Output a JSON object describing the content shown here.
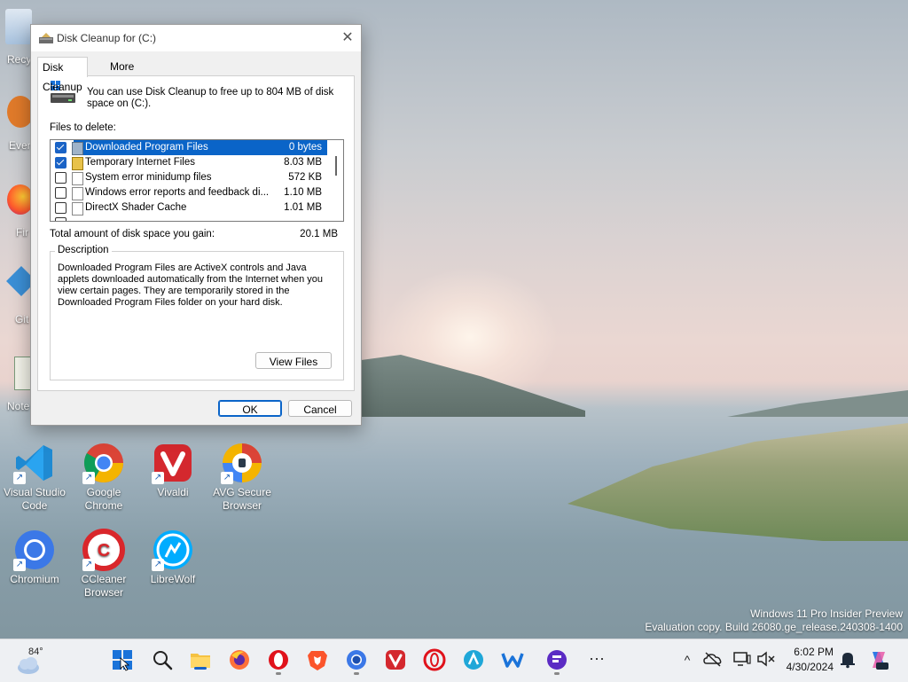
{
  "desktop": {
    "partial_icons": [
      {
        "label": "Recy",
        "icon": "recycle-bin-icon"
      },
      {
        "label": "Ever",
        "icon": "everything-icon"
      },
      {
        "label": "Fir",
        "icon": "firefox-icon"
      },
      {
        "label": "Git",
        "icon": "git-icon"
      },
      {
        "label": "Note",
        "icon": "notepad-icon"
      }
    ],
    "icons": [
      {
        "label": "Visual Studio Code",
        "icon": "vscode-icon"
      },
      {
        "label": "Google Chrome",
        "icon": "chrome-icon"
      },
      {
        "label": "Vivaldi",
        "icon": "vivaldi-icon"
      },
      {
        "label": "AVG Secure Browser",
        "icon": "avg-browser-icon"
      },
      {
        "label": "Chromium",
        "icon": "chromium-icon"
      },
      {
        "label": "CCleaner Browser",
        "icon": "ccleaner-browser-icon"
      },
      {
        "label": "LibreWolf",
        "icon": "librewolf-icon"
      }
    ],
    "watermark": {
      "line1": "Windows 11 Pro Insider Preview",
      "line2": "Evaluation copy. Build 26080.ge_release.240308-1400"
    }
  },
  "dialog": {
    "title": "Disk Cleanup for  (C:)",
    "tabs": [
      "Disk Cleanup",
      "More Options"
    ],
    "active_tab": "Disk Cleanup",
    "intro": "You can use Disk Cleanup to free up to 804 MB of disk space on  (C:).",
    "files_label": "Files to delete:",
    "files": [
      {
        "name": "Downloaded Program Files",
        "size": "0 bytes",
        "checked": true,
        "selected": true,
        "icon": "folder-icon"
      },
      {
        "name": "Temporary Internet Files",
        "size": "8.03 MB",
        "checked": true,
        "selected": false,
        "icon": "lock-icon"
      },
      {
        "name": "System error minidump files",
        "size": "572 KB",
        "checked": false,
        "selected": false,
        "icon": "file-icon"
      },
      {
        "name": "Windows error reports and feedback di...",
        "size": "1.10 MB",
        "checked": false,
        "selected": false,
        "icon": "file-icon"
      },
      {
        "name": "DirectX Shader Cache",
        "size": "1.01 MB",
        "checked": false,
        "selected": false,
        "icon": "file-icon"
      }
    ],
    "total_label": "Total amount of disk space you gain:",
    "total_value": "20.1 MB",
    "description_legend": "Description",
    "description": "Downloaded Program Files are ActiveX controls and Java applets downloaded automatically from the Internet when you view certain pages. They are temporarily stored in the Downloaded Program Files folder on your hard disk.",
    "view_files_label": "View Files",
    "ok_label": "OK",
    "cancel_label": "Cancel",
    "close_glyph": "✕"
  },
  "taskbar": {
    "weather_temp": "84°",
    "apps": [
      "start-icon",
      "search-icon",
      "file-explorer-icon",
      "firefox-icon",
      "opera-icon",
      "brave-icon",
      "chromium-icon",
      "vivaldi-icon",
      "opera-gx-icon",
      "maxthon-icon",
      "waterfox-icon",
      "floorp-icon"
    ],
    "more_glyph": "···",
    "tray_chevron": "^",
    "time": "6:02 PM",
    "date": "4/30/2024"
  }
}
